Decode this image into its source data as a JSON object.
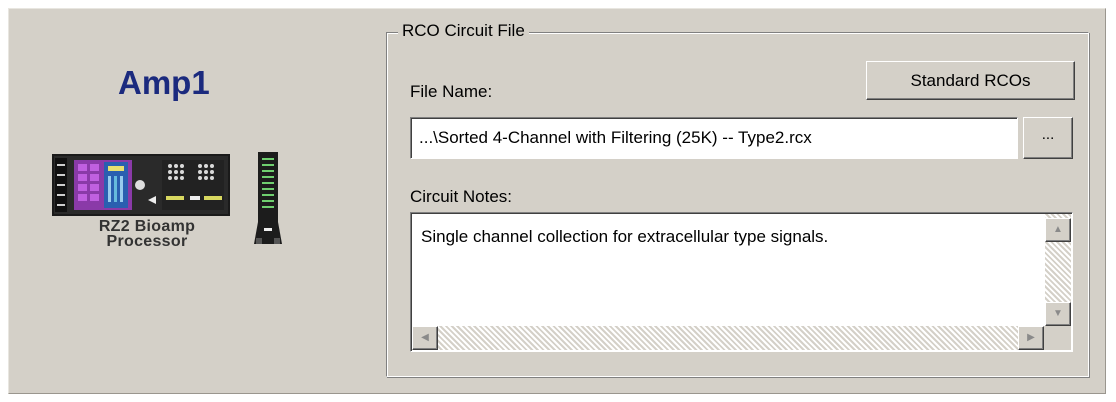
{
  "device": {
    "name": "Amp1",
    "caption_line1": "RZ2 Bioamp",
    "caption_line2": "Processor"
  },
  "circuit_group": {
    "title": "RCO Circuit File",
    "file_name_label": "File Name:",
    "standard_button_label": "Standard RCOs",
    "file_name_value": "...\\Sorted 4-Channel with Filtering (25K) -- Type2.rcx",
    "browse_button_label": "...",
    "notes_label": "Circuit Notes:",
    "notes_value": "Single channel collection for extracellular type signals."
  },
  "icons": {
    "scroll_up": "▲",
    "scroll_down": "▼",
    "scroll_left": "◀",
    "scroll_right": "▶"
  },
  "colors": {
    "panel_bg": "#d4d0c8",
    "device_name": "#1b2a7e"
  }
}
